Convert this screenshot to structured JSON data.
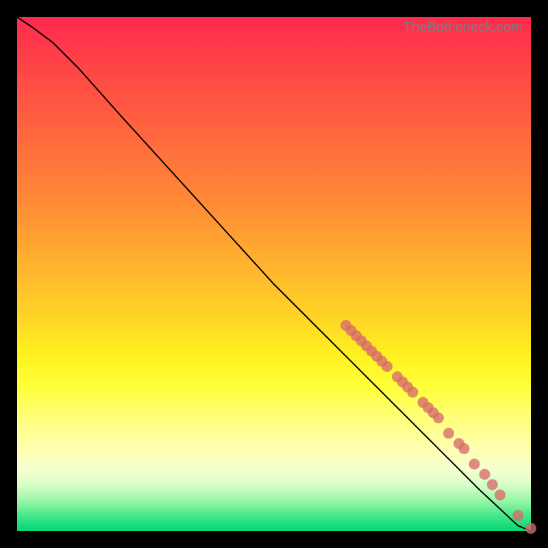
{
  "watermark": "TheBottleneck.com",
  "colors": {
    "dot": "#d76a6a",
    "curve": "#000000",
    "frame": "#000000"
  },
  "chart_data": {
    "type": "line",
    "title": "",
    "xlabel": "",
    "ylabel": "",
    "xlim": [
      0,
      100
    ],
    "ylim": [
      0,
      100
    ],
    "grid": false,
    "legend": false,
    "curve": [
      {
        "x": 0,
        "y": 100
      },
      {
        "x": 3,
        "y": 98
      },
      {
        "x": 7,
        "y": 95
      },
      {
        "x": 12,
        "y": 90
      },
      {
        "x": 20,
        "y": 81
      },
      {
        "x": 30,
        "y": 70
      },
      {
        "x": 40,
        "y": 59
      },
      {
        "x": 50,
        "y": 48
      },
      {
        "x": 60,
        "y": 38
      },
      {
        "x": 70,
        "y": 28
      },
      {
        "x": 80,
        "y": 18
      },
      {
        "x": 90,
        "y": 8
      },
      {
        "x": 97.5,
        "y": 1
      },
      {
        "x": 100,
        "y": 0
      }
    ],
    "dots": [
      {
        "x": 64,
        "y": 40
      },
      {
        "x": 65,
        "y": 39
      },
      {
        "x": 66,
        "y": 38
      },
      {
        "x": 67,
        "y": 37
      },
      {
        "x": 68,
        "y": 36
      },
      {
        "x": 69,
        "y": 35
      },
      {
        "x": 70,
        "y": 34
      },
      {
        "x": 71,
        "y": 33
      },
      {
        "x": 72,
        "y": 32
      },
      {
        "x": 74,
        "y": 30
      },
      {
        "x": 75,
        "y": 29
      },
      {
        "x": 76,
        "y": 28
      },
      {
        "x": 77,
        "y": 27
      },
      {
        "x": 79,
        "y": 25
      },
      {
        "x": 80,
        "y": 24
      },
      {
        "x": 81,
        "y": 23
      },
      {
        "x": 82,
        "y": 22
      },
      {
        "x": 84,
        "y": 19
      },
      {
        "x": 86,
        "y": 17
      },
      {
        "x": 87,
        "y": 16
      },
      {
        "x": 89,
        "y": 13
      },
      {
        "x": 91,
        "y": 11
      },
      {
        "x": 92.5,
        "y": 9
      },
      {
        "x": 94,
        "y": 7
      },
      {
        "x": 97.5,
        "y": 3
      },
      {
        "x": 100,
        "y": 0.5
      }
    ]
  }
}
